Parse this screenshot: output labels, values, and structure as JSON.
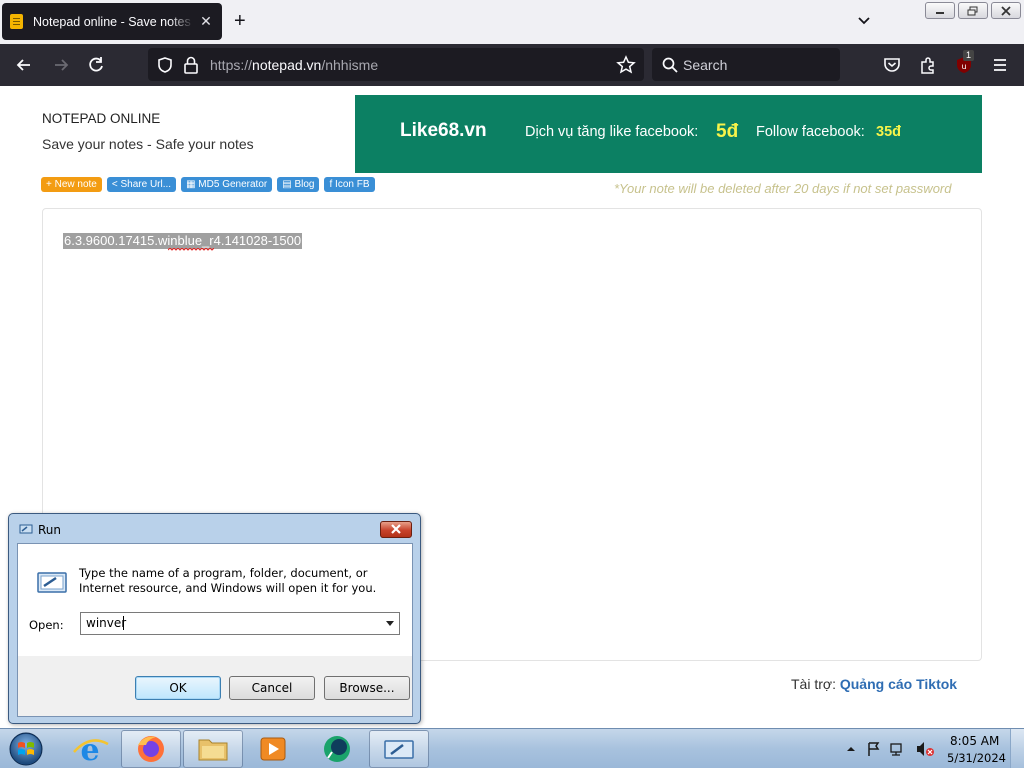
{
  "browser": {
    "tab_title": "Notepad online - Save notes online",
    "tab_close": "✕",
    "new_tab": "+",
    "url_scheme": "https://",
    "url_host": "notepad.vn",
    "url_path": "/nhhisme",
    "search_placeholder": "Search",
    "extension_badge": "1"
  },
  "page": {
    "site_title": "NOTEPAD ONLINE",
    "site_slogan": "Save your notes - Safe your notes",
    "ad": {
      "brand": "Like68.vn",
      "like_text": "Dịch vụ tăng like facebook:",
      "like_price": "5đ",
      "follow_text": "Follow facebook:",
      "follow_price": "35đ",
      "colors": {
        "background": "#0c8063",
        "price": "#f7f34a"
      }
    },
    "buttons": [
      {
        "label": "+ New note",
        "color": "orange"
      },
      {
        "label": "< Share Url...",
        "color": "blue"
      },
      {
        "label": "▦ MD5 Generator",
        "color": "blue"
      },
      {
        "label": "▤ Blog",
        "color": "blue"
      },
      {
        "label": "f Icon FB",
        "color": "blue"
      }
    ],
    "warning": "*Your note will be deleted after 20 days if not set password",
    "note_content": "6.3.9600.17415.winblue_r4.141028-1500",
    "sponsor_label": "Tài trợ:",
    "sponsor_link": "Quảng cáo Tiktok"
  },
  "run_dialog": {
    "title": "Run",
    "description": "Type the name of a program, folder, document, or Internet resource, and Windows will open it for you.",
    "open_label": "Open:",
    "open_value": "winver",
    "ok_label": "OK",
    "cancel_label": "Cancel",
    "browse_label": "Browse..."
  },
  "taskbar": {
    "items": [
      "start-orb",
      "internet-explorer",
      "firefox",
      "file-explorer",
      "media-player",
      "app-green-circle",
      "run-dialog"
    ],
    "clock_time": "8:05 AM",
    "clock_date": "5/31/2024"
  }
}
